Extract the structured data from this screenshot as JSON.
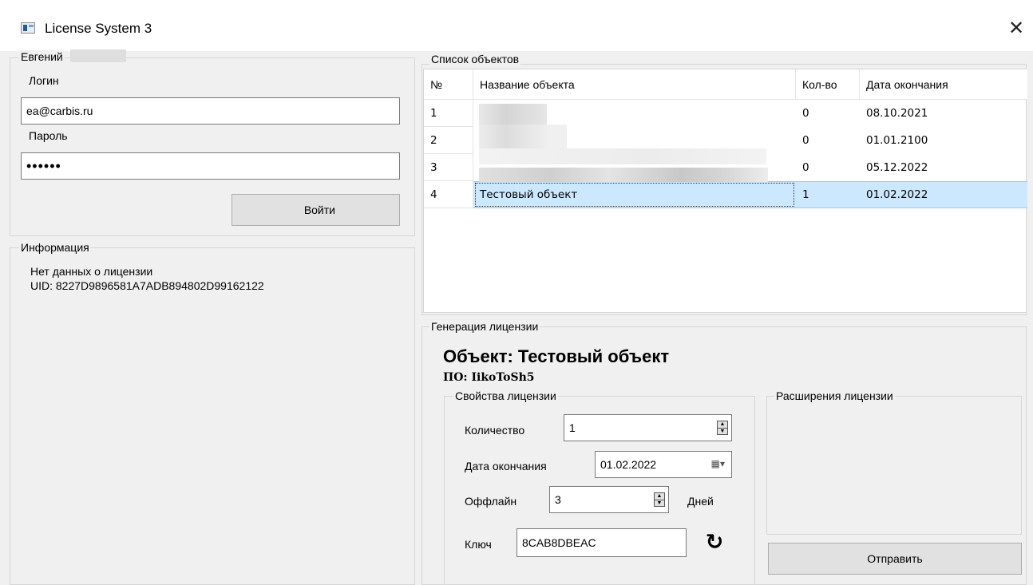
{
  "window": {
    "title": "License System 3"
  },
  "user": {
    "name": "Евгений",
    "login_label": "Логин",
    "login_value": "ea@carbis.ru",
    "password_label": "Пароль",
    "password_value": "••••••",
    "login_button": "Войти"
  },
  "info": {
    "title": "Информация",
    "line1": "Нет данных о лицензии",
    "line2": "UID: 8227D9896581A7ADB894802D99162122"
  },
  "objects": {
    "title": "Список объектов",
    "columns": [
      "№",
      "Название объекта",
      "Кол-во",
      "Дата окончания"
    ],
    "rows": [
      {
        "num": "1",
        "name": "",
        "qty": "0",
        "date": "08.10.2021"
      },
      {
        "num": "2",
        "name": "",
        "qty": "0",
        "date": "01.01.2100"
      },
      {
        "num": "3",
        "name": "",
        "qty": "0",
        "date": "05.12.2022"
      },
      {
        "num": "4",
        "name": "Тестовый объект",
        "qty": "1",
        "date": "01.02.2022"
      }
    ]
  },
  "generation": {
    "title": "Генерация лицензии",
    "object_heading": "Объект: Тестовый объект",
    "software": "ПО: IikoToSh5",
    "properties": {
      "title": "Свойства лицензии",
      "quantity_label": "Количество",
      "quantity_value": "1",
      "end_date_label": "Дата окончания",
      "end_date_value": "01.02.2022",
      "offline_label": "Оффлайн",
      "offline_value": "3",
      "offline_unit": "Дней",
      "key_label": "Ключ",
      "key_value": "8CAB8DBEAC"
    },
    "extensions_title": "Расширения лицензии",
    "send_button": "Отправить"
  }
}
